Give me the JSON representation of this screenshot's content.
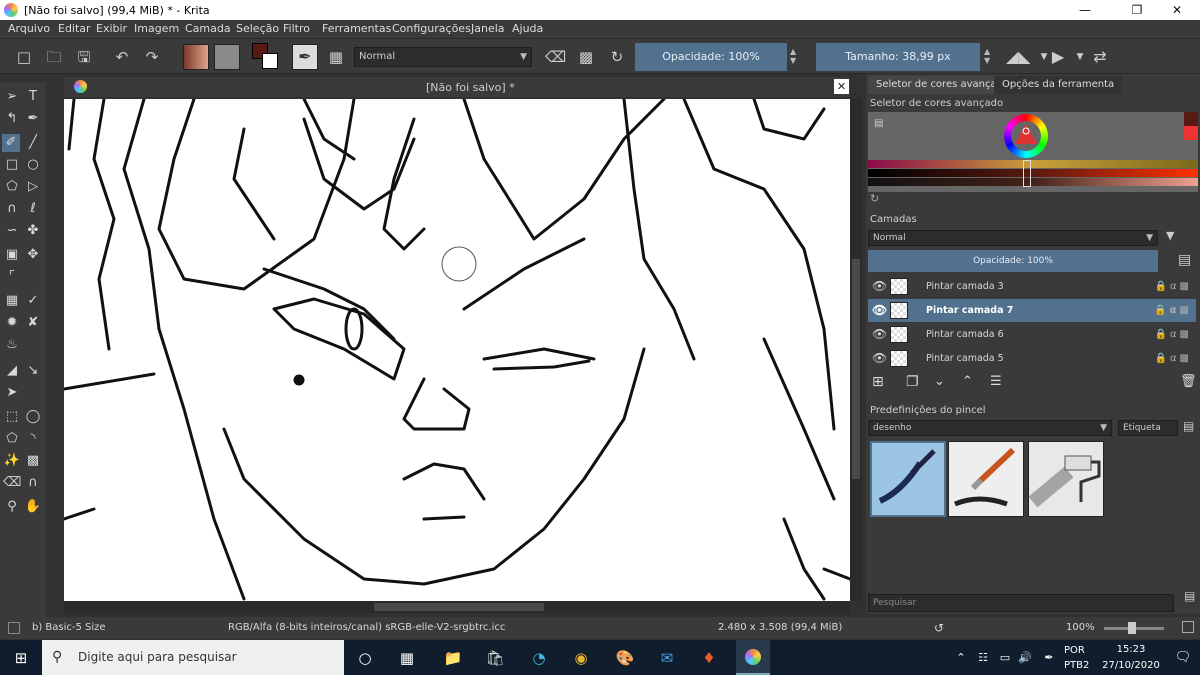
{
  "window": {
    "title": "[Não foi salvo]  (99,4 MiB)  * - Krita"
  },
  "menu": [
    "Arquivo",
    "Editar",
    "Exibir",
    "Imagem",
    "Camada",
    "Seleção",
    "Filtro",
    "Ferramentas",
    "Configurações",
    "Janela",
    "Ajuda"
  ],
  "toolbar": {
    "blend_mode": "Normal",
    "opacity_label": "Opacidade: 100%",
    "size_label": "Tamanho: 38,99 px",
    "fg_color": "#5a1a14",
    "bg_color": "#ffffff"
  },
  "document": {
    "tab_title": "[Não foi salvo]  *"
  },
  "dock": {
    "tabs": [
      "Seletor de cores avançado",
      "Opções da ferramenta"
    ],
    "color_selector_title": "Seletor de cores avançado",
    "layers_title": "Camadas",
    "layer_blend": "Normal",
    "layer_opacity": "Opacidade:  100%",
    "layers": [
      {
        "name": "Pintar camada 3",
        "selected": false
      },
      {
        "name": "Pintar camada 7",
        "selected": true
      },
      {
        "name": "Pintar camada 6",
        "selected": false
      },
      {
        "name": "Pintar camada 5",
        "selected": false
      }
    ],
    "brush_title": "Predefinições do pincel",
    "brush_tag": "desenho",
    "tag_button": "Etiqueta",
    "search_placeholder": "Pesquisar"
  },
  "status": {
    "brush": "b) Basic-5 Size",
    "color_space": "RGB/Alfa (8-bits inteiros/canal)  sRGB-elle-V2-srgbtrc.icc",
    "dimensions": "2.480 x 3.508 (99,4 MiB)",
    "zoom": "100%"
  },
  "taskbar": {
    "search_placeholder": "Digite aqui para pesquisar",
    "lang_top": "POR",
    "lang_bottom": "PTB2",
    "time": "15:23",
    "date": "27/10/2020"
  }
}
